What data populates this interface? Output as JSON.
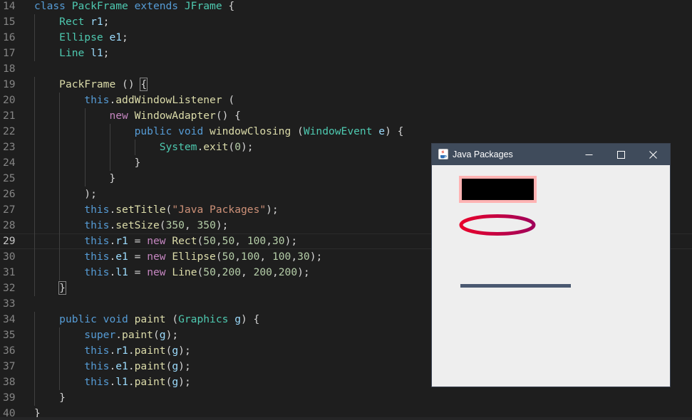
{
  "editor": {
    "lines": [
      {
        "n": "14",
        "tokens": [
          [
            "kw",
            "class "
          ],
          [
            "ty",
            "PackFrame "
          ],
          [
            "kw",
            "extends "
          ],
          [
            "ty",
            "JFrame "
          ],
          [
            "pn",
            "{"
          ]
        ]
      },
      {
        "n": "15",
        "tokens": [
          [
            "pn",
            "    "
          ],
          [
            "ty",
            "Rect "
          ],
          [
            "va",
            "r1"
          ],
          [
            "pn",
            ";"
          ]
        ]
      },
      {
        "n": "16",
        "tokens": [
          [
            "pn",
            "    "
          ],
          [
            "ty",
            "Ellipse "
          ],
          [
            "va",
            "e1"
          ],
          [
            "pn",
            ";"
          ]
        ]
      },
      {
        "n": "17",
        "tokens": [
          [
            "pn",
            "    "
          ],
          [
            "ty",
            "Line "
          ],
          [
            "va",
            "l1"
          ],
          [
            "pn",
            ";"
          ]
        ]
      },
      {
        "n": "18",
        "tokens": []
      },
      {
        "n": "19",
        "tokens": [
          [
            "pn",
            "    "
          ],
          [
            "fn",
            "PackFrame "
          ],
          [
            "pn",
            "() "
          ],
          [
            "br",
            "{"
          ]
        ]
      },
      {
        "n": "20",
        "tokens": [
          [
            "pn",
            "        "
          ],
          [
            "kw",
            "this"
          ],
          [
            "pn",
            "."
          ],
          [
            "fn",
            "addWindowListener "
          ],
          [
            "pn",
            "("
          ]
        ]
      },
      {
        "n": "21",
        "tokens": [
          [
            "pn",
            "            "
          ],
          [
            "cl",
            "new "
          ],
          [
            "fn",
            "WindowAdapter"
          ],
          [
            "pn",
            "() {"
          ]
        ]
      },
      {
        "n": "22",
        "tokens": [
          [
            "pn",
            "                "
          ],
          [
            "kw",
            "public void "
          ],
          [
            "fn",
            "windowClosing "
          ],
          [
            "pn",
            "("
          ],
          [
            "ty",
            "WindowEvent "
          ],
          [
            "va",
            "e"
          ],
          [
            "pn",
            ") {"
          ]
        ]
      },
      {
        "n": "23",
        "tokens": [
          [
            "pn",
            "                    "
          ],
          [
            "ty",
            "System"
          ],
          [
            "pn",
            "."
          ],
          [
            "fn",
            "exit"
          ],
          [
            "pn",
            "("
          ],
          [
            "nu",
            "0"
          ],
          [
            "pn",
            ");"
          ]
        ]
      },
      {
        "n": "24",
        "tokens": [
          [
            "pn",
            "                }"
          ]
        ]
      },
      {
        "n": "25",
        "tokens": [
          [
            "pn",
            "            }"
          ]
        ]
      },
      {
        "n": "26",
        "tokens": [
          [
            "pn",
            "        );"
          ]
        ]
      },
      {
        "n": "27",
        "tokens": [
          [
            "pn",
            "        "
          ],
          [
            "kw",
            "this"
          ],
          [
            "pn",
            "."
          ],
          [
            "fn",
            "setTitle"
          ],
          [
            "pn",
            "("
          ],
          [
            "st",
            "\"Java Packages\""
          ],
          [
            "pn",
            ");"
          ]
        ]
      },
      {
        "n": "28",
        "tokens": [
          [
            "pn",
            "        "
          ],
          [
            "kw",
            "this"
          ],
          [
            "pn",
            "."
          ],
          [
            "fn",
            "setSize"
          ],
          [
            "pn",
            "("
          ],
          [
            "nu",
            "350"
          ],
          [
            "pn",
            ", "
          ],
          [
            "nu",
            "350"
          ],
          [
            "pn",
            ");"
          ]
        ]
      },
      {
        "n": "29",
        "tokens": [
          [
            "pn",
            "        "
          ],
          [
            "kw",
            "this"
          ],
          [
            "pn",
            "."
          ],
          [
            "va",
            "r1"
          ],
          [
            "pn",
            " = "
          ],
          [
            "cl",
            "new "
          ],
          [
            "fn",
            "Rect"
          ],
          [
            "pn",
            "("
          ],
          [
            "nu",
            "50"
          ],
          [
            "pn",
            ","
          ],
          [
            "nu",
            "50"
          ],
          [
            "pn",
            ", "
          ],
          [
            "nu",
            "100"
          ],
          [
            "pn",
            ","
          ],
          [
            "nu",
            "30"
          ],
          [
            "pn",
            ");"
          ]
        ]
      },
      {
        "n": "30",
        "tokens": [
          [
            "pn",
            "        "
          ],
          [
            "kw",
            "this"
          ],
          [
            "pn",
            "."
          ],
          [
            "va",
            "e1"
          ],
          [
            "pn",
            " = "
          ],
          [
            "cl",
            "new "
          ],
          [
            "fn",
            "Ellipse"
          ],
          [
            "pn",
            "("
          ],
          [
            "nu",
            "50"
          ],
          [
            "pn",
            ","
          ],
          [
            "nu",
            "100"
          ],
          [
            "pn",
            ", "
          ],
          [
            "nu",
            "100"
          ],
          [
            "pn",
            ","
          ],
          [
            "nu",
            "30"
          ],
          [
            "pn",
            ");"
          ]
        ]
      },
      {
        "n": "31",
        "tokens": [
          [
            "pn",
            "        "
          ],
          [
            "kw",
            "this"
          ],
          [
            "pn",
            "."
          ],
          [
            "va",
            "l1"
          ],
          [
            "pn",
            " = "
          ],
          [
            "cl",
            "new "
          ],
          [
            "fn",
            "Line"
          ],
          [
            "pn",
            "("
          ],
          [
            "nu",
            "50"
          ],
          [
            "pn",
            ","
          ],
          [
            "nu",
            "200"
          ],
          [
            "pn",
            ", "
          ],
          [
            "nu",
            "200"
          ],
          [
            "pn",
            ","
          ],
          [
            "nu",
            "200"
          ],
          [
            "pn",
            ");"
          ]
        ]
      },
      {
        "n": "32",
        "tokens": [
          [
            "pn",
            "    "
          ],
          [
            "br",
            "}"
          ]
        ]
      },
      {
        "n": "33",
        "tokens": []
      },
      {
        "n": "34",
        "tokens": [
          [
            "pn",
            "    "
          ],
          [
            "kw",
            "public void "
          ],
          [
            "fn",
            "paint "
          ],
          [
            "pn",
            "("
          ],
          [
            "ty",
            "Graphics "
          ],
          [
            "va",
            "g"
          ],
          [
            "pn",
            ") {"
          ]
        ]
      },
      {
        "n": "35",
        "tokens": [
          [
            "pn",
            "        "
          ],
          [
            "kw",
            "super"
          ],
          [
            "pn",
            "."
          ],
          [
            "fn",
            "paint"
          ],
          [
            "pn",
            "("
          ],
          [
            "va",
            "g"
          ],
          [
            "pn",
            ");"
          ]
        ]
      },
      {
        "n": "36",
        "tokens": [
          [
            "pn",
            "        "
          ],
          [
            "kw",
            "this"
          ],
          [
            "pn",
            "."
          ],
          [
            "va",
            "r1"
          ],
          [
            "pn",
            "."
          ],
          [
            "fn",
            "paint"
          ],
          [
            "pn",
            "("
          ],
          [
            "va",
            "g"
          ],
          [
            "pn",
            ");"
          ]
        ]
      },
      {
        "n": "37",
        "tokens": [
          [
            "pn",
            "        "
          ],
          [
            "kw",
            "this"
          ],
          [
            "pn",
            "."
          ],
          [
            "va",
            "e1"
          ],
          [
            "pn",
            "."
          ],
          [
            "fn",
            "paint"
          ],
          [
            "pn",
            "("
          ],
          [
            "va",
            "g"
          ],
          [
            "pn",
            ");"
          ]
        ]
      },
      {
        "n": "38",
        "tokens": [
          [
            "pn",
            "        "
          ],
          [
            "kw",
            "this"
          ],
          [
            "pn",
            "."
          ],
          [
            "va",
            "l1"
          ],
          [
            "pn",
            "."
          ],
          [
            "fn",
            "paint"
          ],
          [
            "pn",
            "("
          ],
          [
            "va",
            "g"
          ],
          [
            "pn",
            ");"
          ]
        ]
      },
      {
        "n": "39",
        "tokens": [
          [
            "pn",
            "    }"
          ]
        ]
      },
      {
        "n": "40",
        "tokens": [
          [
            "pn",
            "}"
          ]
        ]
      }
    ],
    "current_line": "29"
  },
  "java_window": {
    "title": "Java Packages",
    "icon": "java-cup-icon",
    "buttons": {
      "minimize": "minimize-icon",
      "maximize": "maximize-icon",
      "close": "close-icon"
    },
    "colors": {
      "titlebar": "#3f4b5b",
      "client": "#eeeeee",
      "rect_fill": "#000000",
      "rect_border": "#ffb3b3",
      "ellipse_from": "#e8002a",
      "ellipse_to": "#a0005a",
      "line": "#4a5870"
    }
  }
}
